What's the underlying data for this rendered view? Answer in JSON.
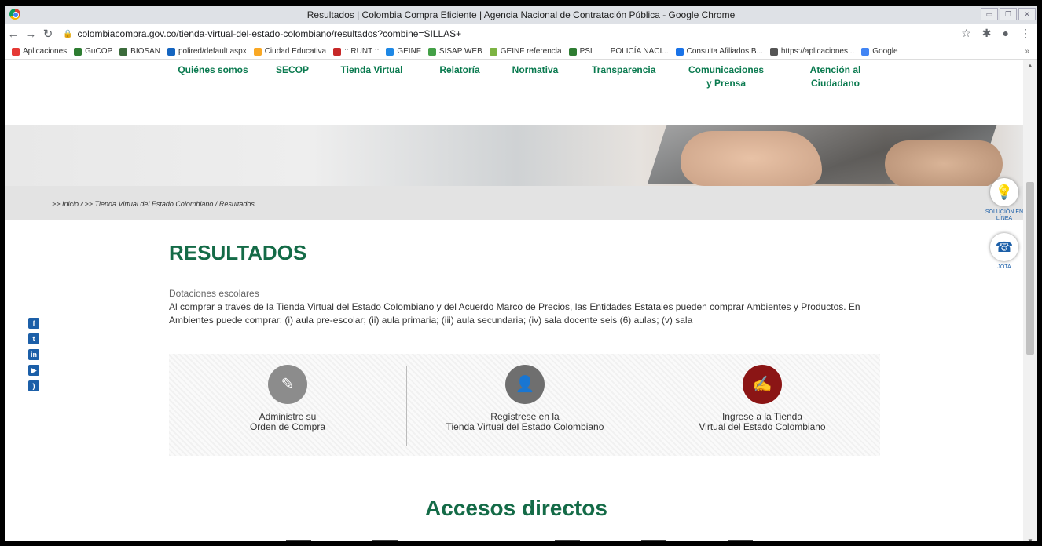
{
  "window": {
    "title": "Resultados | Colombia Compra Eficiente | Agencia Nacional de Contratación Pública - Google Chrome"
  },
  "address_bar": {
    "url": "colombiacompra.gov.co/tienda-virtual-del-estado-colombiano/resultados?combine=SILLAS+"
  },
  "bookmarks": [
    {
      "label": "Aplicaciones",
      "color": "#e53935"
    },
    {
      "label": "GuCOP",
      "color": "#2e7d32"
    },
    {
      "label": "BIOSAN",
      "color": "#3b6b3b"
    },
    {
      "label": "polired/default.aspx",
      "color": "#1565c0"
    },
    {
      "label": "Ciudad Educativa",
      "color": "#f9a825"
    },
    {
      "label": ":: RUNT ::",
      "color": "#c62828"
    },
    {
      "label": "GEINF",
      "color": "#1e88e5"
    },
    {
      "label": "SISAP WEB",
      "color": "#43a047"
    },
    {
      "label": "GEINF referencia",
      "color": "#7cb342"
    },
    {
      "label": "PSI",
      "color": "#2e7d32"
    },
    {
      "label": "POLICÍA NACI...",
      "color": "#ffffff"
    },
    {
      "label": "Consulta Afiliados B...",
      "color": "#1a73e8"
    },
    {
      "label": "https://aplicaciones...",
      "color": "#555555"
    },
    {
      "label": "Google",
      "color": "#4285f4"
    }
  ],
  "nav": [
    {
      "label": "Quiénes somos"
    },
    {
      "label": "SECOP"
    },
    {
      "label": "Tienda Virtual"
    },
    {
      "label": "Relatoría"
    },
    {
      "label": "Normativa"
    },
    {
      "label": "Transparencia"
    },
    {
      "label": "Comunicaciones y Prensa"
    },
    {
      "label": "Atención al Ciudadano"
    }
  ],
  "breadcrumb": ">> Inicio / >> Tienda Virtual del Estado Colombiano / Resultados",
  "page_title": "RESULTADOS",
  "description": {
    "subtitle": "Dotaciones escolares",
    "text": "Al comprar a través de la Tienda Virtual del Estado Colombiano y del Acuerdo Marco de Precios, las Entidades Estatales pueden comprar Ambientes y Productos. En Ambientes puede comprar: (i) aula pre-escolar; (ii) aula primaria; (iii) aula secundaria; (iv) sala docente seis (6) aulas; (v) sala"
  },
  "actions": [
    {
      "label1": "Administre su",
      "label2": "Orden de Compra",
      "color": "#8c8c8c",
      "icon": "edit-icon"
    },
    {
      "label1": "Regístrese en la",
      "label2": "Tienda Virtual del Estado Colombiano",
      "color": "#6f6f6f",
      "icon": "add-user-icon"
    },
    {
      "label1": "Ingrese a la Tienda",
      "label2": "Virtual del Estado Colombiano",
      "color": "#8b1515",
      "icon": "signature-icon"
    }
  ],
  "accesos_title": "Accesos directos",
  "side_tools": [
    {
      "label": "SOLUCIÓN EN LÍNEA",
      "icon": "lightbulb-icon"
    },
    {
      "label": "JOTA",
      "icon": "chat-icon"
    }
  ],
  "social": [
    "f",
    "t",
    "in",
    "yt",
    "rss"
  ]
}
